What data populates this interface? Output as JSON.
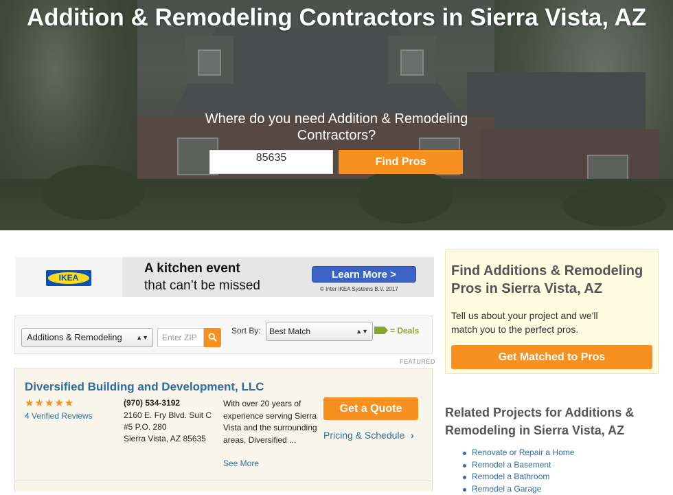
{
  "hero": {
    "title": "Addition & Remodeling Contractors in Sierra Vista, AZ",
    "question": "Where do you need Addition & Remodeling Contractors?",
    "zip_value": "85635",
    "find_button": "Find Pros"
  },
  "ad": {
    "logo_text": "IKEA",
    "line1": "A kitchen event",
    "line2": "that can’t be missed",
    "cta": "Learn More >",
    "copyright": "© Inter IKEA Systems B.V. 2017"
  },
  "filters": {
    "category": "Additions & Remodeling",
    "zip_placeholder": "Enter ZIP",
    "sort_label": "Sort By:",
    "sort_value": "Best Match",
    "deals_label": "= Deals",
    "featured_label": "FEATURED"
  },
  "listing": {
    "name": "Diversified Building and Development, LLC",
    "stars": "★★★★★",
    "rating": 5,
    "reviews": "4 Verified Reviews",
    "phone": "(970) 534-3192",
    "address_lines": [
      "2160 E. Fry Blvd. Suit C",
      "#5 P.O. 280",
      "Sierra Vista, AZ 85635"
    ],
    "description": "With over 20 years of experience serving Sierra Vista and the surrounding areas, Diversified ...",
    "see_more": "See More",
    "quote_button": "Get a Quote",
    "pricing_link": "Pricing & Schedule",
    "pricing_arrow": "›"
  },
  "sidebar": {
    "match_title": "Find Additions & Remodeling Pros in Sierra Vista, AZ",
    "match_desc": "Tell us about your project and we'll match you to the perfect pros.",
    "match_button": "Get Matched to Pros",
    "related_title": "Related Projects for Additions & Remodeling in Sierra Vista, AZ",
    "related_items": [
      "Renovate or Repair a Home",
      "Remodel a Basement",
      "Remodel a Bathroom",
      "Remodel a Garage"
    ]
  },
  "colors": {
    "accent_orange": "#f7901e",
    "link_blue": "#2d6ca2",
    "deals_green": "#8aa52c"
  }
}
